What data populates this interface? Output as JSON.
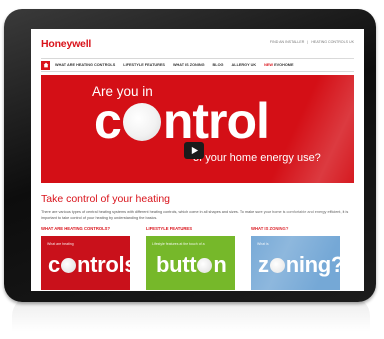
{
  "site": {
    "logo": "Honeywell",
    "top_links": [
      "FIND AN INSTALLER",
      "HEATING CONTROLS UK"
    ]
  },
  "nav": {
    "home_icon": "house-icon",
    "items": [
      "WHAT ARE HEATING CONTROLS",
      "LIFESTYLE FEATURES",
      "WHAT IS ZONING",
      "BLOG",
      "ALLERGY UK"
    ],
    "new_tag": "NEW",
    "new_item": "EVOHOME"
  },
  "hero": {
    "line1": "Are you in",
    "big_prefix": "c",
    "big_suffix": "ntrol",
    "line3": "of your home energy use?",
    "play_icon": "play-icon"
  },
  "section": {
    "title": "Take control of your heating",
    "body": "There are various types of central heating systems with different heating controls, which come in all shapes and sizes. To make sure your home is comfortable and energy efficient, it is important to take control of your heating by understanding the basics."
  },
  "columns": [
    {
      "heading": "WHAT ARE HEATING CONTROLS?",
      "caption": "What are heating",
      "word_prefix": "c",
      "word_suffix": "ntrols?"
    },
    {
      "heading": "LIFESTYLE FEATURES",
      "caption": "Lifestyle features at the touch of a",
      "word_prefix": "butt",
      "word_suffix": "n"
    },
    {
      "heading": "WHAT IS ZONING?",
      "caption": "What is",
      "word_prefix": "z",
      "word_suffix": "ning?"
    }
  ],
  "colors": {
    "brand_red": "#d9131b",
    "green": "#76b82a",
    "blue": "#75a8d6"
  }
}
